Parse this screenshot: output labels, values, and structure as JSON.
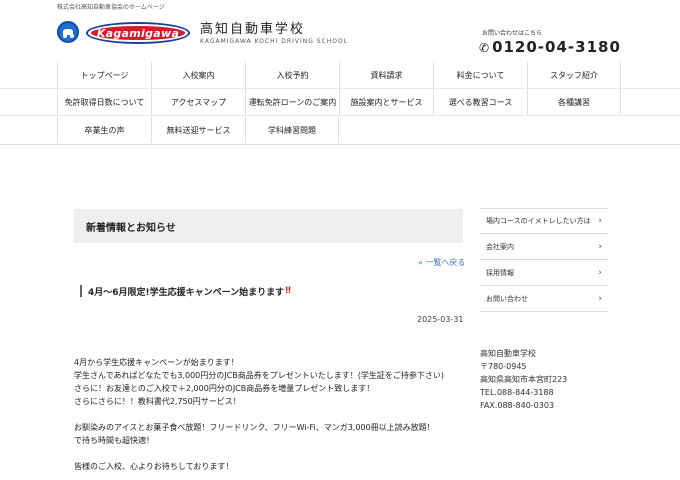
{
  "header": {
    "top_tagline": "株式会社高知自動車協会のホームページ",
    "logo_text": "Kagamigawa",
    "school_name": "高知自動車学校",
    "school_name_en": "KAGAMIGAWA KOCHI DRIVING SCHOOL",
    "contact_label": "お問い合わせはこちら",
    "phone": "0120-04-3180"
  },
  "nav": {
    "row1": [
      "トップページ",
      "入校案内",
      "入校予約",
      "資料請求",
      "料金について",
      "スタッフ紹介"
    ],
    "row2": [
      "免許取得日数について",
      "アクセスマップ",
      "運転免許ローンのご案内",
      "施設案内とサービス",
      "選べる教習コース",
      "各種講習"
    ],
    "row3": [
      "卒業生の声",
      "無料送迎サービス",
      "学科練習問題"
    ]
  },
  "main": {
    "section_heading": "新着情報とお知らせ",
    "back_link": "« 一覧へ戻る",
    "post_title": "4月〜6月限定!学生応援キャンペーン始まります",
    "post_title_mark": "‼",
    "post_date": "2025-03-31",
    "paragraph1": [
      "4月から学生応援キャンペーンが始まります！",
      "学生さんであればどなたでも3,000円分のJCB商品券をプレゼントいたします！(学生証をご持参下さい)",
      "さらに！お友達とのご入校で＋2,000円分のJCB商品券を増量プレゼント致します！",
      "さらにさらに！！教科書代2,750円サービス！"
    ],
    "paragraph2": [
      "お馴染みのアイスとお菓子食べ放題！フリードリンク、フリーWi-Fi、マンガ3,000冊以上読み放題！",
      "で待ち時間も超快適！"
    ],
    "paragraph3": [
      "皆様のご入校、心よりお待ちしております！"
    ]
  },
  "sidebar": {
    "menu": [
      "場内コースのイメトレしたい方は",
      "会社案内",
      "採用情報",
      "お問い合わせ"
    ],
    "info": [
      "高知自動車学校",
      "〒780-0945",
      "高知県高知市本宮町223",
      "TEL.088-844-3188",
      "FAX.088-840-0303"
    ]
  }
}
